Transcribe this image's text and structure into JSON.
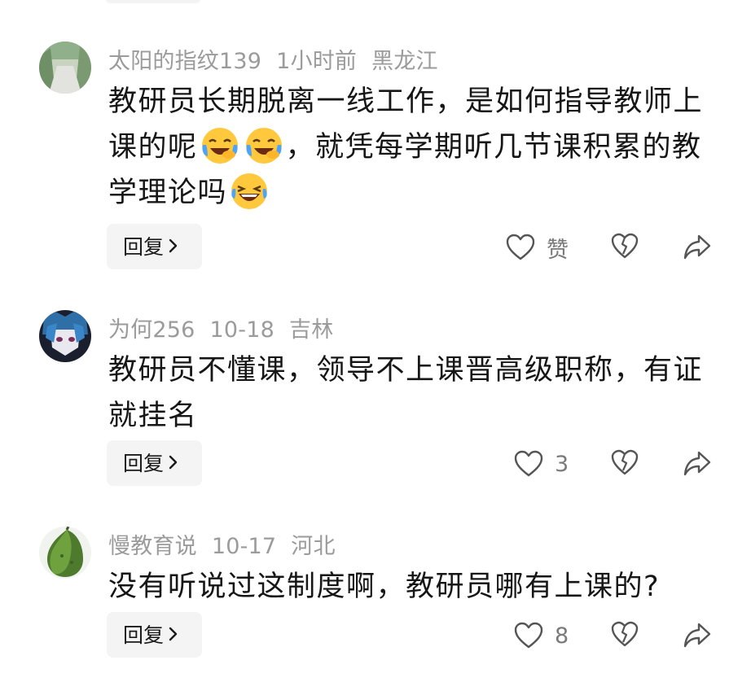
{
  "comments": [
    {
      "username": "太阳的指纹139",
      "time": "1小时前",
      "location": "黑龙江",
      "text_parts": [
        "教研员长期脱离一线工作，是如何指导教师上课的呢",
        "，就凭每学期听几节课积累的教学理论吗"
      ],
      "emojis": [
        "crying-laughing-emoji",
        "crying-laughing-emoji",
        "laughing-tears-emoji"
      ],
      "reply_label": "回复",
      "like_label": "赞"
    },
    {
      "username": "为何256",
      "time": "10-18",
      "location": "吉林",
      "text": "教研员不懂课，领导不上课晋高级职称，有证就挂名",
      "reply_label": "回复",
      "like_count": "3"
    },
    {
      "username": "慢教育说",
      "time": "10-17",
      "location": "河北",
      "text": "没有听说过这制度啊，教研员哪有上课的?",
      "reply_label": "回复",
      "like_count": "8"
    }
  ],
  "icons": {
    "like": "heart-outline-icon",
    "dislike": "broken-heart-icon",
    "share": "share-arrow-icon",
    "reply_chevron": "chevron-right-icon"
  },
  "colors": {
    "meta": "#9b9b9b",
    "text": "#161616",
    "button_bg": "#f4f4f4",
    "icon": "#555555",
    "emoji_yellow": "#ffc83d",
    "tear_blue": "#4aa3ff"
  }
}
